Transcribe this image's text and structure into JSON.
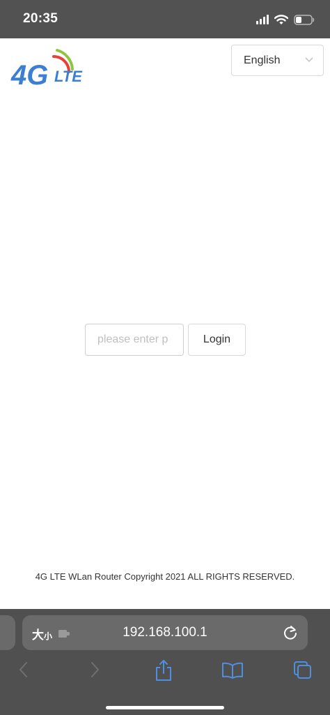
{
  "status_bar": {
    "time": "20:35",
    "icons": [
      "cellular-signal-icon",
      "wifi-icon",
      "battery-icon"
    ]
  },
  "header": {
    "logo_text": "4G LTE",
    "language_select": {
      "selected": "English"
    }
  },
  "login": {
    "password_placeholder": "please enter p",
    "password_value": "",
    "login_label": "Login"
  },
  "footer": {
    "copyright": "4G LTE WLan Router Copyright 2021 ALL RIGHTS RESERVED."
  },
  "browser": {
    "text_size_label_large": "大",
    "text_size_label_small": "小",
    "url": "192.168.100.1",
    "toolbar": [
      "back-icon",
      "forward-icon",
      "share-icon",
      "bookmarks-icon",
      "tabs-icon"
    ]
  },
  "colors": {
    "browser_chrome": "#505050",
    "status_bar": "#525252",
    "accent_blue": "#4f8fe0",
    "logo_blue": "#3b7fd0",
    "logo_green": "#8dc63f",
    "logo_red": "#e8403a"
  }
}
